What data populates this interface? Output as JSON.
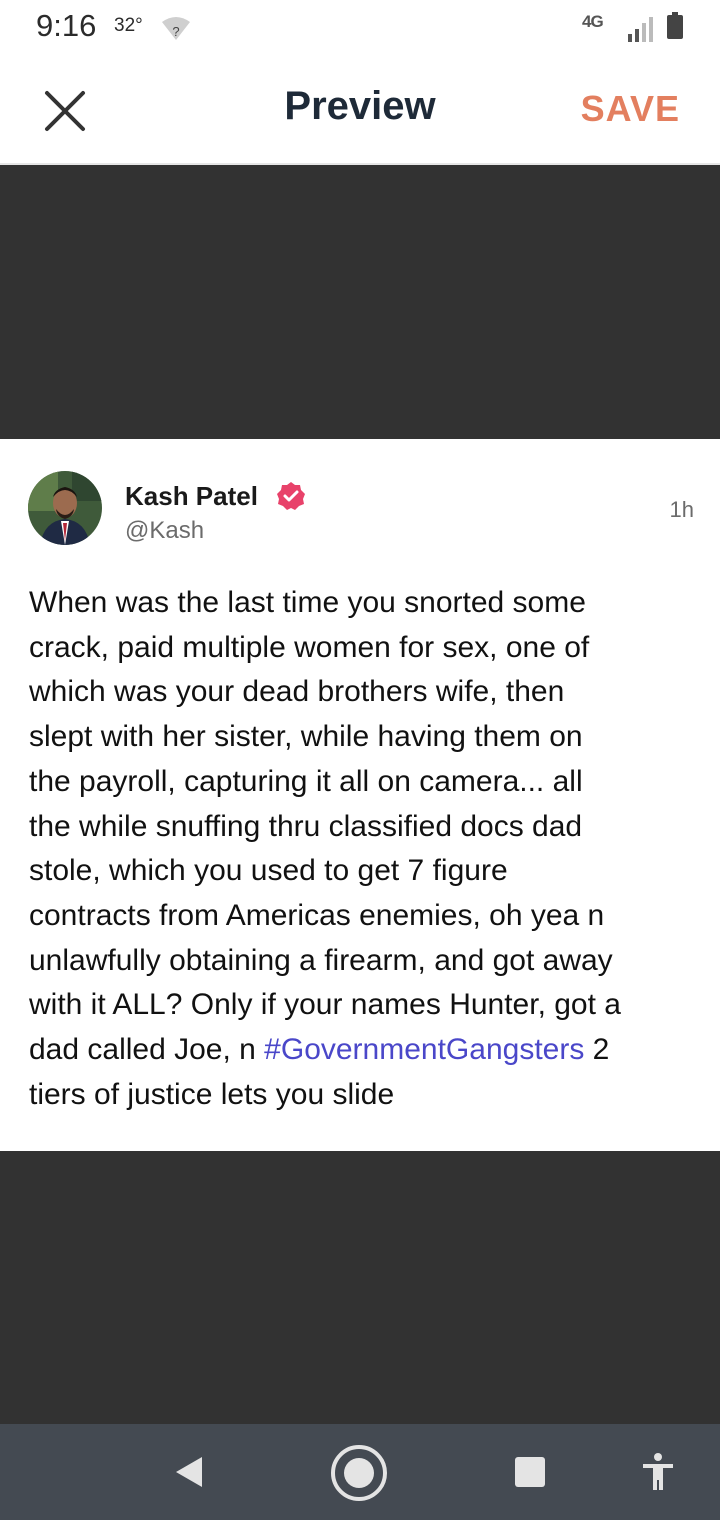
{
  "status_bar": {
    "time": "9:16",
    "temperature": "32°",
    "network": "4G",
    "battery_level": "82"
  },
  "app_bar": {
    "close_icon": "close-icon",
    "title": "Preview",
    "save_label": "SAVE"
  },
  "tweet": {
    "author_name": "Kash Patel",
    "handle": "@Kash",
    "timestamp": "1h",
    "text_before": "When was the last time you snorted some\ncrack, paid multiple women for sex, one of\nwhich was your dead brothers wife, then\nslept with her sister, while having them on\nthe payroll, capturing it all on camera... all\nthe while snuffing thru classified docs dad\nstole, which you used to get 7 figure\ncontracts from Americas enemies, oh yea n\nunlawfully obtaining a firearm, and got away\nwith it ALL? Only if your names Hunter, got a\ndad called Joe, n ",
    "hashtag": "#GovernmentGangsters",
    "text_after": " 2\ntiers of justice lets you slide"
  },
  "colors": {
    "accent_save": "#e37f5f",
    "hashtag": "#4a47c9",
    "verified_badge": "#e8426a",
    "backdrop": "#323232",
    "nav_bar": "#444a52"
  },
  "nav_bar": {
    "back_icon": "back-triangle-icon",
    "home_icon": "home-circle-icon",
    "recents_icon": "recents-square-icon",
    "accessibility_icon": "accessibility-icon"
  }
}
